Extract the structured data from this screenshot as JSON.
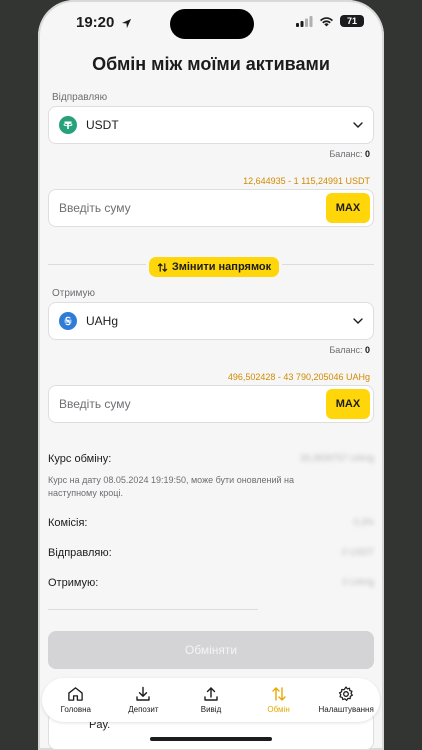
{
  "status": {
    "time": "19:20",
    "battery": "71"
  },
  "title": "Обмін між моїми активами",
  "send": {
    "label": "Відправляю",
    "currency": "USDT",
    "balance_label": "Баланс:",
    "balance_value": "0",
    "range": "12,644935 - 1 115,24991 USDT",
    "placeholder": "Введіть суму",
    "max_label": "MAX"
  },
  "swap_label": "Змінити напрямок",
  "receive": {
    "label": "Отримую",
    "currency": "UAHg",
    "balance_label": "Баланс:",
    "balance_value": "0",
    "range": "496,502428 - 43 790,205046 UAHg",
    "placeholder": "Введіть суму",
    "max_label": "MAX"
  },
  "info": {
    "rate_label": "Курс обміну:",
    "rate_value": "39,3839757 UAHg",
    "note": "Курс на дату 08.05.2024 19:19:50, може бути оновлений на наступному кроці.",
    "fee_label": "Комісія:",
    "fee_value": "0,3%",
    "sending_label": "Відправляю:",
    "sending_value": "0 USDT",
    "receiving_label": "Отримую:",
    "receiving_value": "0 UAHg"
  },
  "exchange_button": "Обміняти",
  "under_text": "Pay.",
  "tabs": [
    {
      "label": "Головна",
      "icon": "home-icon"
    },
    {
      "label": "Депозит",
      "icon": "download-icon"
    },
    {
      "label": "Вивід",
      "icon": "upload-icon"
    },
    {
      "label": "Обмін",
      "icon": "swap-icon",
      "active": true
    },
    {
      "label": "Налаштування",
      "icon": "gear-icon"
    }
  ],
  "colors": {
    "accent": "#ffd60a",
    "range": "#d18a00",
    "usdt": "#26a17b",
    "uahg": "#2f7bd8"
  }
}
